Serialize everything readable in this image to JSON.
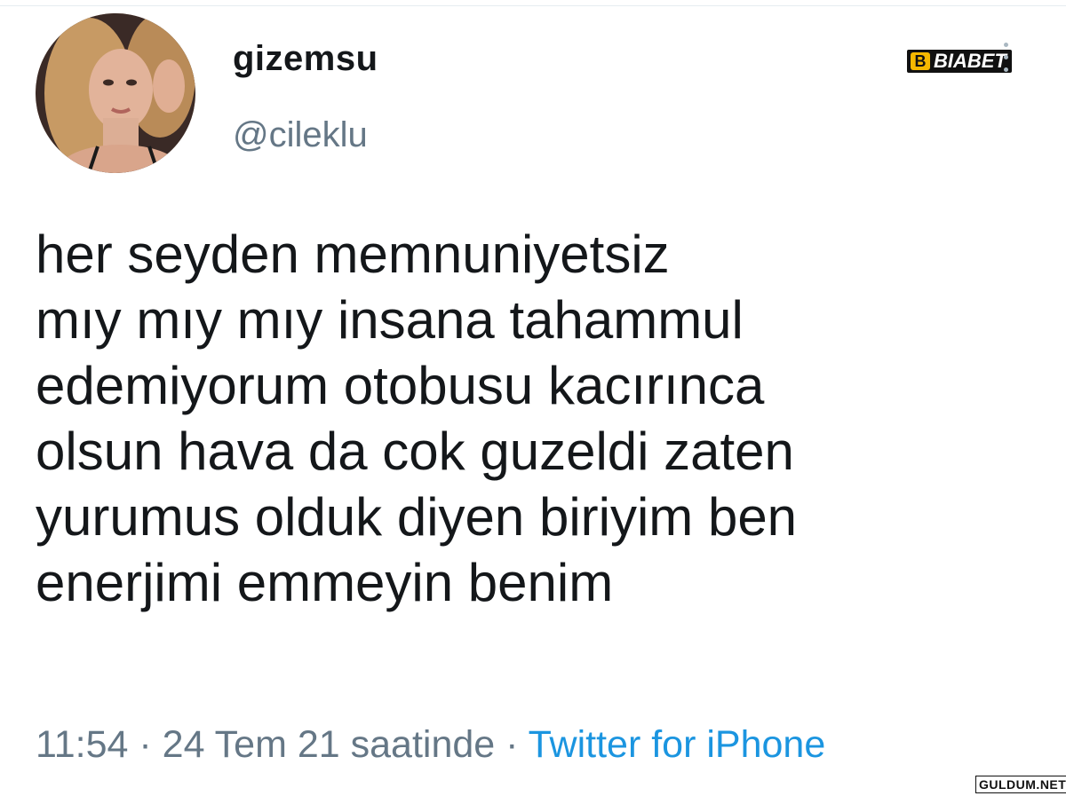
{
  "tweet": {
    "author": {
      "display_name": "gizemsu",
      "handle": "@cileklu",
      "avatar_icon": "profile-photo"
    },
    "text_lines": [
      "her seyden memnuniyetsiz",
      "mıy mıy mıy insana tahammul",
      "edemiyorum otobusu kacırınca",
      "olsun hava da cok guzeldi zaten",
      "yurumus olduk diyen biriyim ben",
      "enerjimi emmeyin benim"
    ],
    "time": "11:54",
    "separator": "·",
    "date": "24 Tem 21 saatinde",
    "source": "Twitter for iPhone",
    "more_icon": "more-vertical-icon"
  },
  "watermarks": {
    "top": "BIABET",
    "top_mark": "B",
    "bottom": "GULDUM.NET"
  },
  "colors": {
    "text": "#14171a",
    "muted": "#657786",
    "link": "#1b95e0"
  }
}
